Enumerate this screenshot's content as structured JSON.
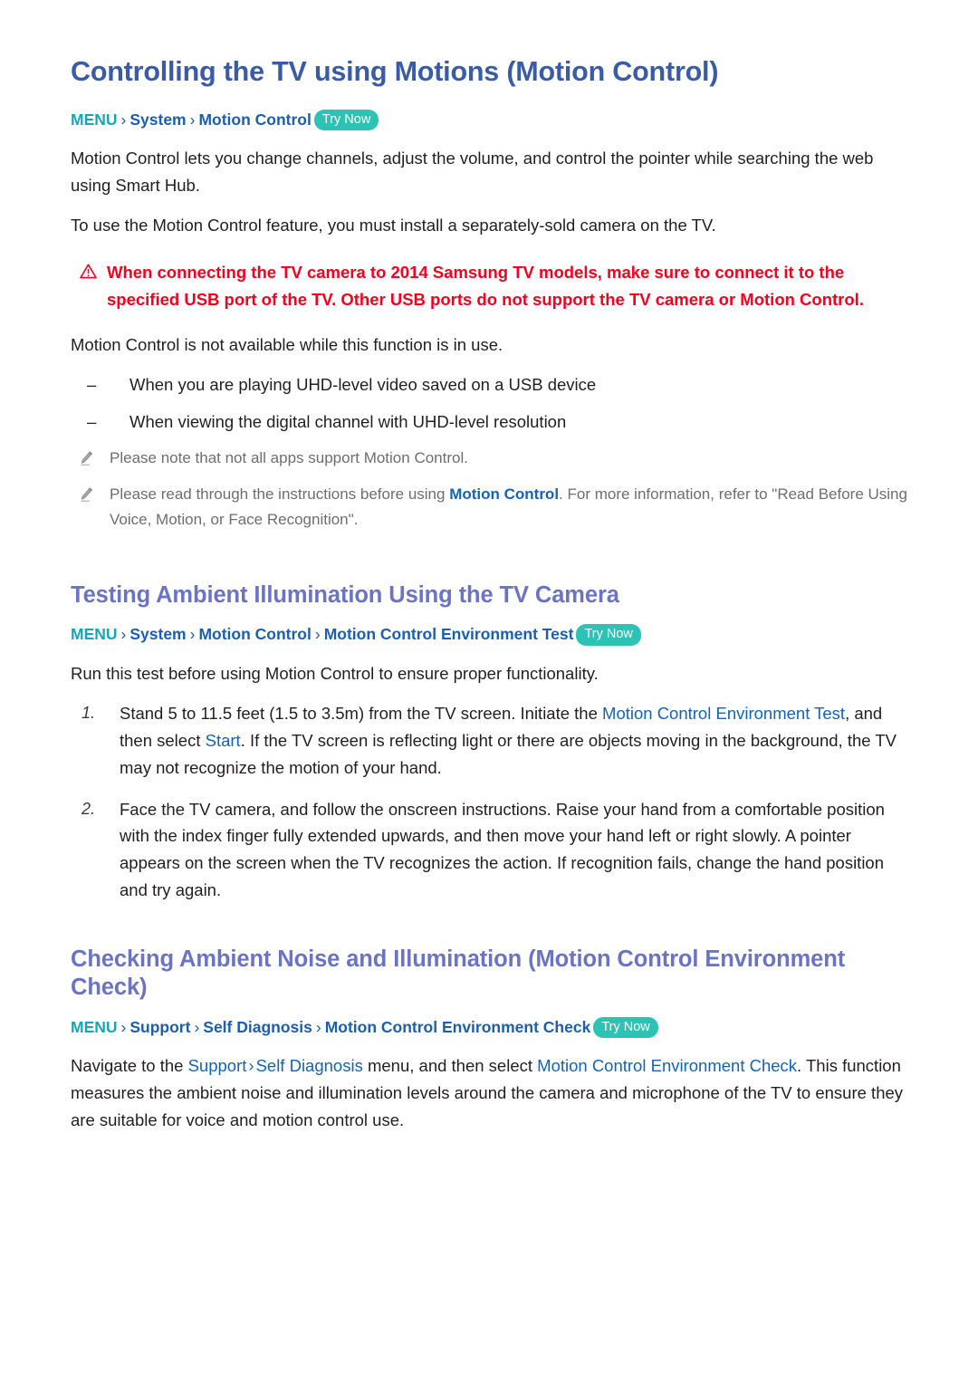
{
  "document": {
    "title": "Controlling the TV using Motions (Motion Control)"
  },
  "colors": {
    "title_blue": "#3a5ca8",
    "heading_purple": "#6b74c4",
    "link_blue": "#1464b4",
    "menu_teal": "#17a6b8",
    "try_now_bg": "#2cc3b4",
    "warning_red": "#f8001c",
    "note_gray": "#6e6e6e",
    "body_black": "#231f20"
  },
  "section1": {
    "heading": "Controlling the TV using Motions (Motion Control)",
    "breadcrumb": {
      "menu": "MENU",
      "separator": "›",
      "crumbs": [
        "System",
        "Motion Control"
      ],
      "try_now": "Try Now"
    },
    "paragraph1": "Motion Control lets you change channels, adjust the volume, and control the pointer while searching the web using Smart Hub.",
    "paragraph2": "To use the Motion Control feature, you must install a separately-sold camera on the TV.",
    "warning": {
      "icon": "warning-triangle-icon",
      "text": "When connecting the TV camera to 2014 Samsung TV models, make sure to connect it to the specified USB port of the TV. Other USB ports do not support the TV camera or Motion Control."
    },
    "paragraph3": "Motion Control is not available while this function is in use.",
    "dash_items": [
      "When you are playing UHD-level video saved on a USB device",
      "When viewing the digital channel with UHD-level resolution"
    ],
    "dash_marker": "–",
    "notes": [
      {
        "icon": "pencil-icon",
        "prefix": "Please note that not all apps support Motion Control.",
        "link": "",
        "suffix": ""
      },
      {
        "icon": "pencil-icon",
        "prefix": "Please read through the instructions before using ",
        "link": "Motion Control",
        "suffix": ". For more information, refer to \"Read Before Using Voice, Motion, or Face Recognition\"."
      }
    ]
  },
  "section2": {
    "heading": "Testing Ambient Illumination Using the TV Camera",
    "breadcrumb": {
      "menu": "MENU",
      "separator": "›",
      "crumbs": [
        "System",
        "Motion Control",
        "Motion Control Environment Test"
      ],
      "try_now": "Try Now"
    },
    "intro": "Run this test before using Motion Control to ensure proper functionality.",
    "steps": [
      {
        "number": "1.",
        "part1": "Stand 5 to 11.5 feet (1.5 to 3.5m) from the TV screen. Initiate the ",
        "link1": "Motion Control Environment Test",
        "part2": ", and then select ",
        "link2": "Start",
        "part3": ". If the TV screen is reflecting light or there are objects moving in the background, the TV may not recognize the motion of your hand."
      },
      {
        "number": "2.",
        "part1": "Face the TV camera, and follow the onscreen instructions. Raise your hand from a comfortable position with the index finger fully extended upwards, and then move your hand left or right slowly. A pointer appears on the screen when the TV recognizes the action. If recognition fails, change the hand position and try again.",
        "link1": "",
        "part2": "",
        "link2": "",
        "part3": ""
      }
    ]
  },
  "section3": {
    "heading": "Checking Ambient Noise and Illumination (Motion Control Environment Check)",
    "breadcrumb": {
      "menu": "MENU",
      "separator": "›",
      "crumbs": [
        "Support",
        "Self Diagnosis",
        "Motion Control Environment Check"
      ],
      "try_now": "Try Now"
    },
    "paragraph": {
      "part1": "Navigate to the ",
      "link1": "Support",
      "sep": "›",
      "link2": "Self Diagnosis",
      "part2": " menu, and then select ",
      "link3": "Motion Control Environment Check",
      "part3": ". This function measures the ambient noise and illumination levels around the camera and microphone of the TV to ensure they are suitable for voice and motion control use."
    }
  }
}
